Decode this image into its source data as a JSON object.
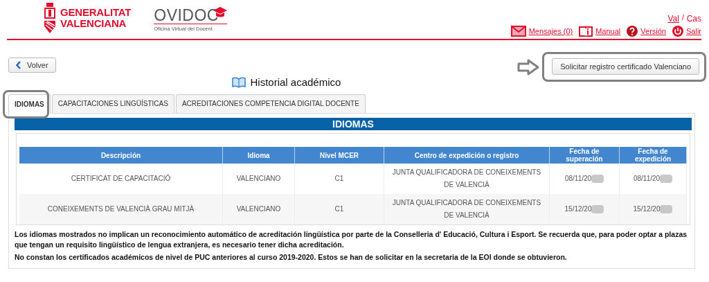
{
  "header": {
    "brand_lines": [
      "GENERALITAT",
      "VALENCIANA"
    ],
    "app_name": "OVIDOC",
    "app_subtitle": "Oficina Virtual del Docent",
    "languages": [
      {
        "label": "Val",
        "selected": false
      },
      {
        "label": "Cas",
        "selected": true
      }
    ],
    "language_separator": "/",
    "nav_links": [
      {
        "label": "Mensajes (0)",
        "kind": "mail"
      },
      {
        "label": "Manual",
        "kind": "manual"
      },
      {
        "label": "Versión",
        "kind": "help"
      },
      {
        "label": "Salir",
        "kind": "power"
      }
    ]
  },
  "back_button": "Volver",
  "page_title": "Historial académico",
  "action_button": {
    "label": "Solicitar registro certificado Valenciano",
    "highlighted": true
  },
  "tabs": [
    {
      "label": "IDIOMAS",
      "selected": true,
      "highlighted": true
    },
    {
      "label": "CAPACITACIONES LINGÜÍSTICAS",
      "selected": false,
      "highlighted": false
    },
    {
      "label": "ACREDITACIONES COMPETENCIA DIGITAL DOCENTE",
      "selected": false,
      "highlighted": false
    }
  ],
  "section_title": "IDIOMAS",
  "table": {
    "columns": [
      "Descripción",
      "Idioma",
      "Nivel MCER",
      "Centro de expedición o registro",
      "Fecha de superación",
      "Fecha de expedición"
    ],
    "rows": [
      {
        "cells": [
          {
            "text": "CERTIFICAT DE CAPACITACIÓ",
            "redacted": false
          },
          {
            "text": "VALENCIANO",
            "redacted": false
          },
          {
            "text": "C1",
            "redacted": false
          },
          {
            "text": "JUNTA QUALIFICADORA DE CONEIXEMENTS DE VALENCIÀ",
            "redacted": false
          },
          {
            "text": "08/11/20",
            "redacted": true
          },
          {
            "text": "08/11/20",
            "redacted": true
          }
        ]
      },
      {
        "cells": [
          {
            "text": "CONEIXEMENTS DE VALENCIÀ GRAU MITJÀ",
            "redacted": false
          },
          {
            "text": "VALENCIANO",
            "redacted": false
          },
          {
            "text": "C1",
            "redacted": false
          },
          {
            "text": "JUNTA QUALIFICADORA DE CONEIXEMENTS DE VALENCIÀ",
            "redacted": false
          },
          {
            "text": "15/12/20",
            "redacted": true
          },
          {
            "text": "15/12/20",
            "redacted": true
          }
        ]
      }
    ]
  },
  "notes": [
    "Los idiomas mostrados no implican un reconocimiento automático de acreditación lingüística por parte de la Conselleria d' Educació, Cultura i Esport. Se recuerda que, para poder optar a plazas que tengan un requisito lingüístico de lengua extranjera, es necesario tener dicha acreditación.",
    "No constan los certificados académicos de nivel de PUC anteriores al curso 2019-2020. Estos se han de solicitar en la secretaria de la EOI donde se obtuvieron."
  ]
}
